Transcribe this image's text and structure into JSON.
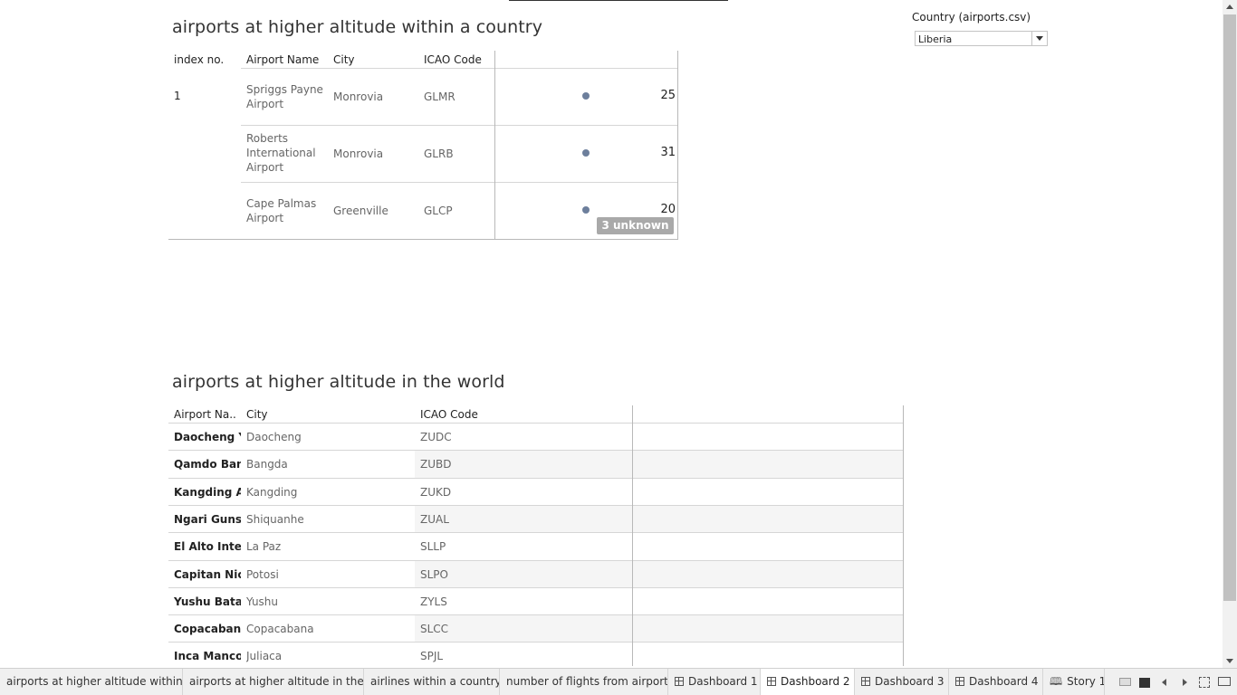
{
  "dashboard": {
    "sheet1": {
      "title": "airports at higher altitude within a country",
      "headers": [
        "index no.",
        "Airport Name",
        "City",
        "ICAO Code"
      ],
      "index_value": "1",
      "rows": [
        {
          "name_lines": [
            "Spriggs Payne",
            "Airport"
          ],
          "city": "Monrovia",
          "icao": "GLMR",
          "value": "25"
        },
        {
          "name_lines": [
            "Roberts",
            "International",
            "Airport"
          ],
          "city": "Monrovia",
          "icao": "GLRB",
          "value": "31"
        },
        {
          "name_lines": [
            "Cape Palmas",
            "Airport"
          ],
          "city": "Greenville",
          "icao": "GLCP",
          "value": "20"
        }
      ],
      "unknown_badge": "3 unknown"
    },
    "filter": {
      "title": "Country (airports.csv)",
      "value": "Liberia"
    },
    "sheet2": {
      "title": "airports at higher altitude in the world",
      "headers": [
        "Airport Na..",
        "City",
        "ICAO Code"
      ],
      "rows": [
        {
          "name": "Daocheng Y..",
          "city": "Daocheng",
          "icao": "ZUDC"
        },
        {
          "name": "Qamdo Ban..",
          "city": "Bangda",
          "icao": "ZUBD"
        },
        {
          "name": "Kangding Ai..",
          "city": "Kangding",
          "icao": "ZUKD"
        },
        {
          "name": "Ngari Guns..",
          "city": "Shiquanhe",
          "icao": "ZUAL"
        },
        {
          "name": "El Alto Inte..",
          "city": "La Paz",
          "icao": "SLLP"
        },
        {
          "name": "Capitan Nic..",
          "city": "Potosi",
          "icao": "SLPO"
        },
        {
          "name": "Yushu Bata..",
          "city": "Yushu",
          "icao": "ZYLS"
        },
        {
          "name": "Copacaban..",
          "city": "Copacabana",
          "icao": "SLCC"
        },
        {
          "name": "Inca Manco ..",
          "city": "Juliaca",
          "icao": "SPJL"
        }
      ]
    }
  },
  "tabs": [
    {
      "label": "airports at higher altitude within ...",
      "icon": "none"
    },
    {
      "label": "airports at higher altitude in the ...",
      "icon": "none"
    },
    {
      "label": "airlines within a country",
      "icon": "none"
    },
    {
      "label": "number of flights from airport",
      "icon": "none"
    },
    {
      "label": "Dashboard 1",
      "icon": "dashboard-icon"
    },
    {
      "label": "Dashboard 2",
      "icon": "dashboard-icon",
      "active": true
    },
    {
      "label": "Dashboard 3",
      "icon": "dashboard-icon"
    },
    {
      "label": "Dashboard 4",
      "icon": "dashboard-icon"
    },
    {
      "label": "Story 1",
      "icon": "story-icon"
    }
  ],
  "colors": {
    "mark": "#6d7f9c",
    "badge": "#a9a9a9",
    "tabbar": "#f0f0f0"
  }
}
